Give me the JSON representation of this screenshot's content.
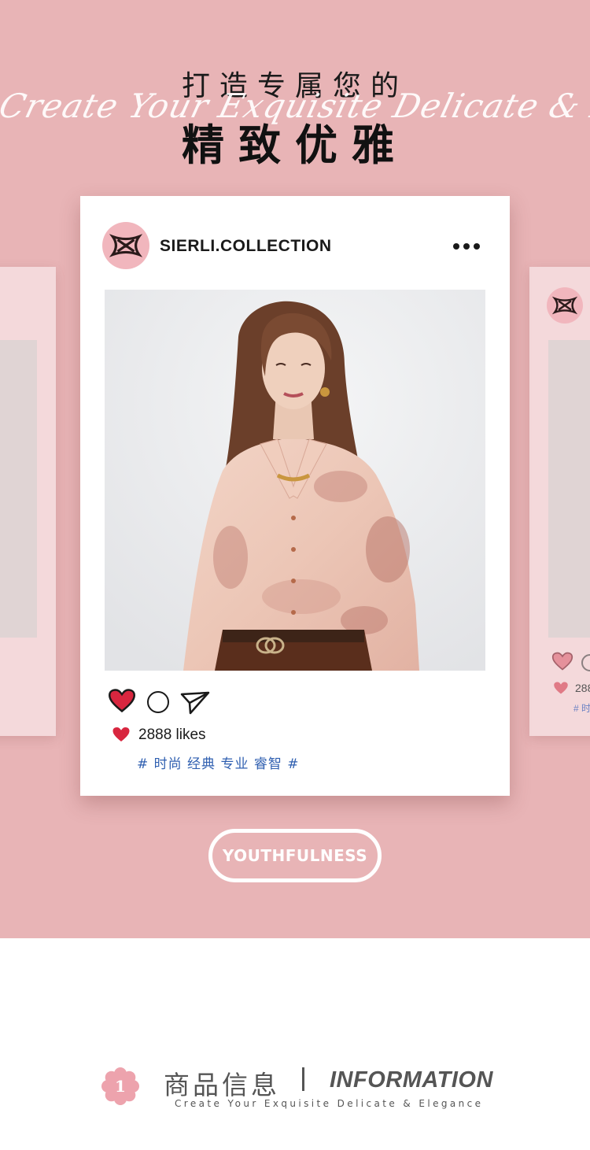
{
  "header": {
    "title_line1": "打造专属您的",
    "script_line": "Create Your Exquisite Delicate & Elegance",
    "title_line2": "精致优雅"
  },
  "post": {
    "username": "SIERLI.COLLECTION",
    "likes": "2888 likes",
    "hashtags": "# 时尚 经典 专业 睿智 #",
    "liked": true
  },
  "side_post": {
    "likes": "288",
    "tag": "# 时"
  },
  "button": {
    "label": "YOUTHFULNESS"
  },
  "section": {
    "number": "1",
    "title_cn": "商品信息",
    "title_en": "INFORMATION",
    "subtitle": "Create Your Exquisite Delicate & Elegance"
  },
  "colors": {
    "background_pink": "#e8b4b6",
    "card_pink": "#f4d9db",
    "avatar_pink": "#f1b6bd",
    "heart_red": "#d8263f",
    "hashtag_blue": "#2f5fb0"
  },
  "icons": [
    "logo-icon",
    "more-icon",
    "heart-icon",
    "comment-icon",
    "share-icon",
    "flower-badge-icon"
  ]
}
